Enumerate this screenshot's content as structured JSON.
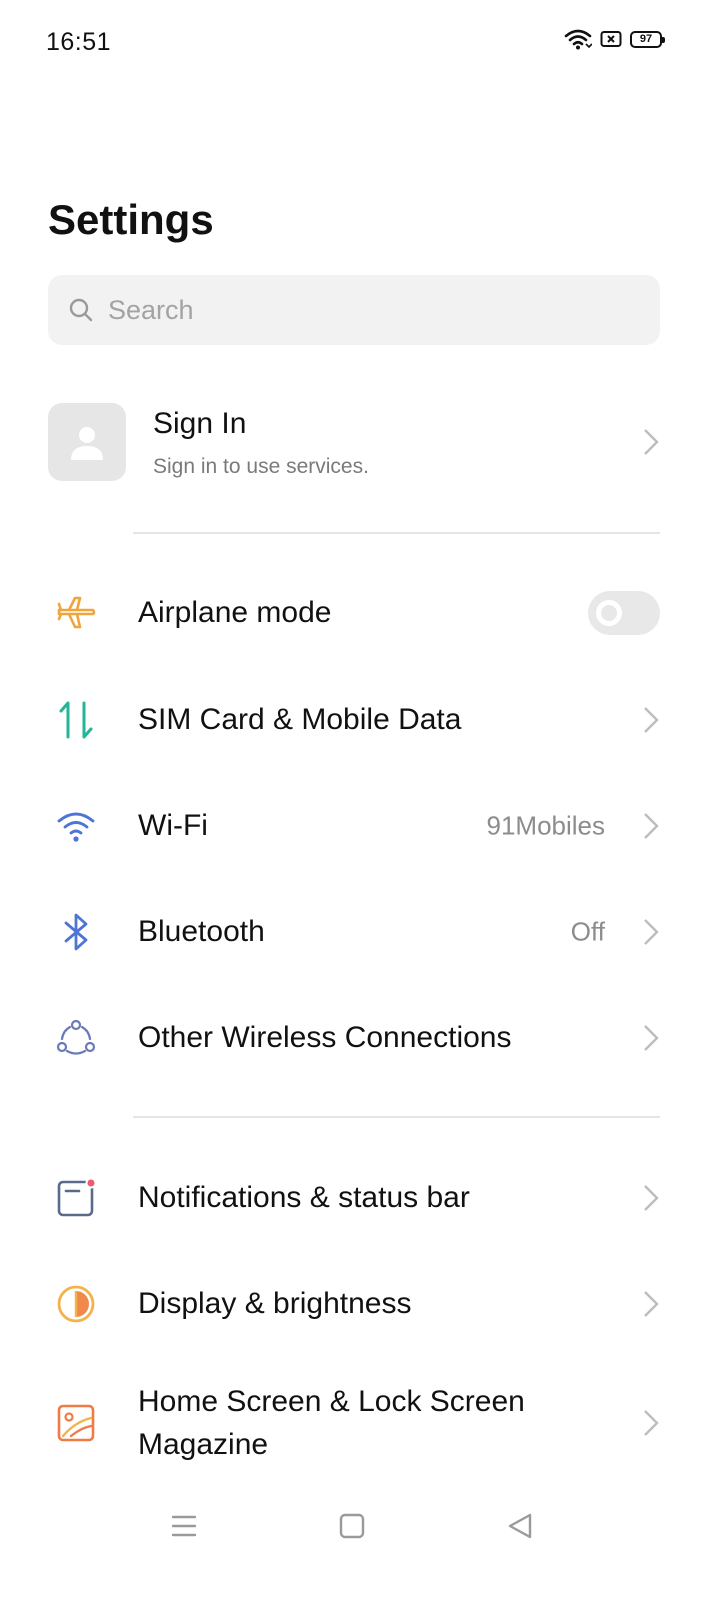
{
  "status_bar": {
    "time": "16:51",
    "battery": "97"
  },
  "page": {
    "title": "Settings"
  },
  "search": {
    "placeholder": "Search"
  },
  "account": {
    "title": "Sign In",
    "subtitle": "Sign in to use services."
  },
  "rows": {
    "airplane": {
      "label": "Airplane mode",
      "toggle_on": false
    },
    "sim": {
      "label": "SIM Card & Mobile Data"
    },
    "wifi": {
      "label": "Wi-Fi",
      "value": "91Mobiles"
    },
    "bluetooth": {
      "label": "Bluetooth",
      "value": "Off"
    },
    "other_wireless": {
      "label": "Other Wireless Connections"
    },
    "notifications": {
      "label": "Notifications & status bar"
    },
    "display": {
      "label": "Display & brightness"
    },
    "home_screen": {
      "label_line1": "Home Screen & Lock Screen",
      "label_line2": "Magazine"
    }
  },
  "icons": {
    "airplane": "airplane-icon",
    "sim": "mobile-data-icon",
    "wifi": "wifi-icon",
    "bluetooth": "bluetooth-icon",
    "other_wireless": "wireless-connections-icon",
    "notifications": "notification-icon",
    "display": "brightness-icon",
    "home_screen": "wallpaper-icon"
  },
  "colors": {
    "airplane": "#f0a43a",
    "sim": "#22b597",
    "wifi": "#4e74d6",
    "bluetooth": "#4e74d6",
    "other_wireless": "#6c7ab8",
    "notifications": "#5a6a8c",
    "notification_dot": "#f0596b",
    "display": "#f08a4b",
    "home_screen": "#ef7b45"
  }
}
